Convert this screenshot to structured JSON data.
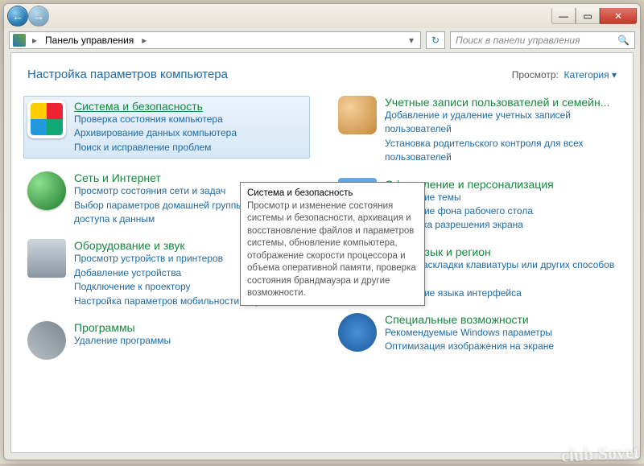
{
  "location": "Панель управления",
  "search_placeholder": "Поиск в панели управления",
  "heading": "Настройка параметров компьютера",
  "view_label": "Просмотр:",
  "view_value": "Категория",
  "tooltip": {
    "title": "Система и безопасность",
    "body": "Просмотр и изменение состояния системы и безопасности, архивация и восстановление файлов и параметров системы, обновление компьютера, отображение скорости процессора и объема оперативной памяти, проверка состояния брандмауэра и другие возможности."
  },
  "left": [
    {
      "title": "Система и безопасность",
      "selected": true,
      "icon": "i-system",
      "tasks": [
        "Проверка состояния компьютера",
        "Архивирование данных компьютера",
        "Поиск и исправление проблем"
      ]
    },
    {
      "title": "Сеть и Интернет",
      "icon": "i-network",
      "tasks": [
        "Просмотр состояния сети и задач",
        "Выбор параметров домашней группы и общего доступа к данным"
      ]
    },
    {
      "title": "Оборудование и звук",
      "icon": "i-hardware",
      "tasks": [
        "Просмотр устройств и принтеров",
        "Добавление устройства",
        "Подключение к проектору",
        "Настройка параметров мобильности по умолчанию"
      ]
    },
    {
      "title": "Программы",
      "icon": "i-programs",
      "tasks": [
        "Удаление программы"
      ]
    }
  ],
  "right": [
    {
      "title": "Учетные записи пользователей и семейн...",
      "icon": "i-users",
      "tasks": [
        "Добавление и удаление учетных записей пользователей",
        "Установка родительского контроля для всех пользователей"
      ]
    },
    {
      "title": "Оформление и персонализация",
      "icon": "i-appear",
      "tasks": [
        "Изменение темы",
        "Изменение фона рабочего стола",
        "Настройка разрешения экрана"
      ]
    },
    {
      "title": "Часы, язык и регион",
      "icon": "i-clock",
      "tasks": [
        "Смена раскладки клавиатуры или других способов ввода",
        "Изменение языка интерфейса"
      ]
    },
    {
      "title": "Специальные возможности",
      "icon": "i-access",
      "tasks": [
        "Рекомендуемые Windows параметры",
        "Оптимизация изображения на экране"
      ]
    }
  ],
  "watermark": "club\nSovet"
}
